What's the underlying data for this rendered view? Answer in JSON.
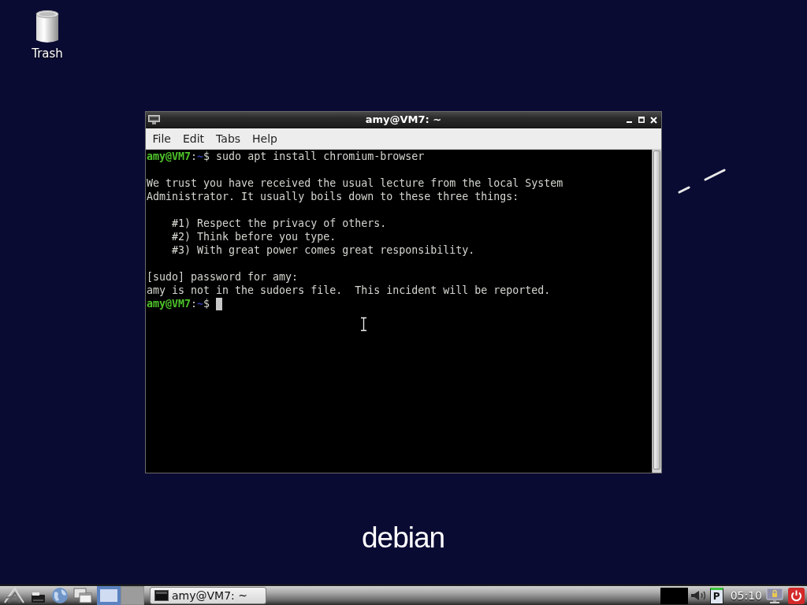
{
  "desktop_icons": [
    {
      "label": "Trash"
    }
  ],
  "terminal_window": {
    "title": "amy@VM7: ~",
    "menu": [
      "File",
      "Edit",
      "Tabs",
      "Help"
    ],
    "lines": [
      {
        "kind": "prompt",
        "user_host": "amy@VM7",
        "separator": ":",
        "path": "~",
        "symbol": "$",
        "command": "sudo apt install chromium-browser",
        "cursor": false
      },
      {
        "kind": "blank"
      },
      {
        "kind": "output",
        "text": "We trust you have received the usual lecture from the local System"
      },
      {
        "kind": "output",
        "text": "Administrator. It usually boils down to these three things:"
      },
      {
        "kind": "blank"
      },
      {
        "kind": "indented",
        "text": "#1) Respect the privacy of others."
      },
      {
        "kind": "indented",
        "text": "#2) Think before you type."
      },
      {
        "kind": "indented",
        "text": "#3) With great power comes great responsibility."
      },
      {
        "kind": "blank"
      },
      {
        "kind": "output",
        "text": "[sudo] password for amy:"
      },
      {
        "kind": "output",
        "text": "amy is not in the sudoers file.  This incident will be reported."
      },
      {
        "kind": "prompt",
        "user_host": "amy@VM7",
        "separator": ":",
        "path": "~",
        "symbol": "$",
        "cursor": true
      }
    ]
  },
  "wallpaper": {
    "logo_text": "debian"
  },
  "taskbar": {
    "workspaces": [
      {
        "selected": true
      },
      {
        "selected": false
      }
    ],
    "tasks": [
      {
        "label": "amy@VM7: ~"
      }
    ],
    "tray_indicator": "P",
    "clock": "05:10"
  }
}
